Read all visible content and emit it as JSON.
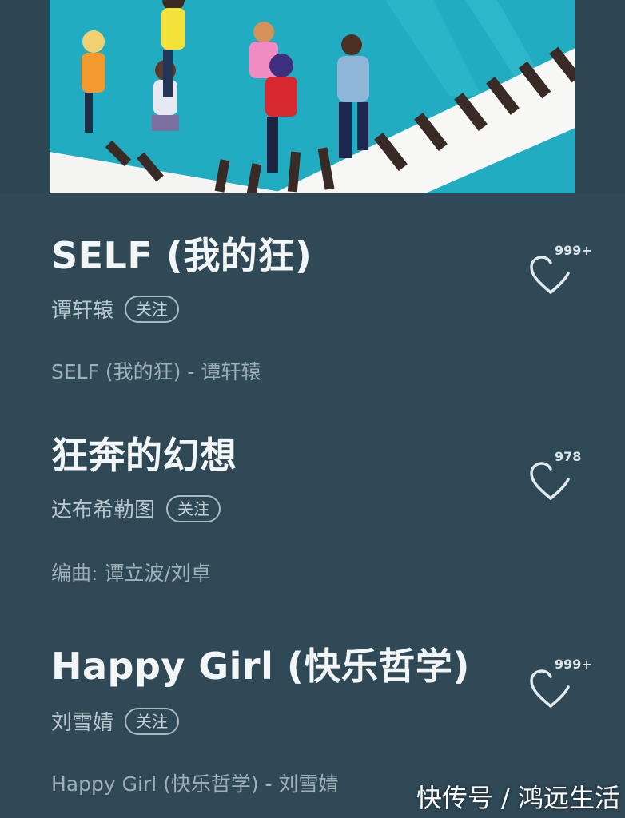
{
  "songs": [
    {
      "title": "SELF (我的狂)",
      "artist": "谭轩辕",
      "follow_label": "关注",
      "detail": "SELF (我的狂) - 谭轩辕",
      "likes": "999+"
    },
    {
      "title": "狂奔的幻想",
      "artist": "达布希勒图",
      "follow_label": "关注",
      "detail": "编曲: 谭立波/刘卓",
      "likes": "978"
    },
    {
      "title": "Happy Girl (快乐哲学)",
      "artist": "刘雪婧",
      "follow_label": "关注",
      "detail": "Happy Girl (快乐哲学) - 刘雪婧",
      "likes": "999+"
    }
  ],
  "watermark": "快传号 / 鸿远生活",
  "colors": {
    "background": "#2c4654",
    "title": "#f3f6f7",
    "secondary": "#b8c6cd",
    "cover_sky": "#1eb4c8"
  },
  "icons": {
    "like": "heart-outline-icon"
  }
}
